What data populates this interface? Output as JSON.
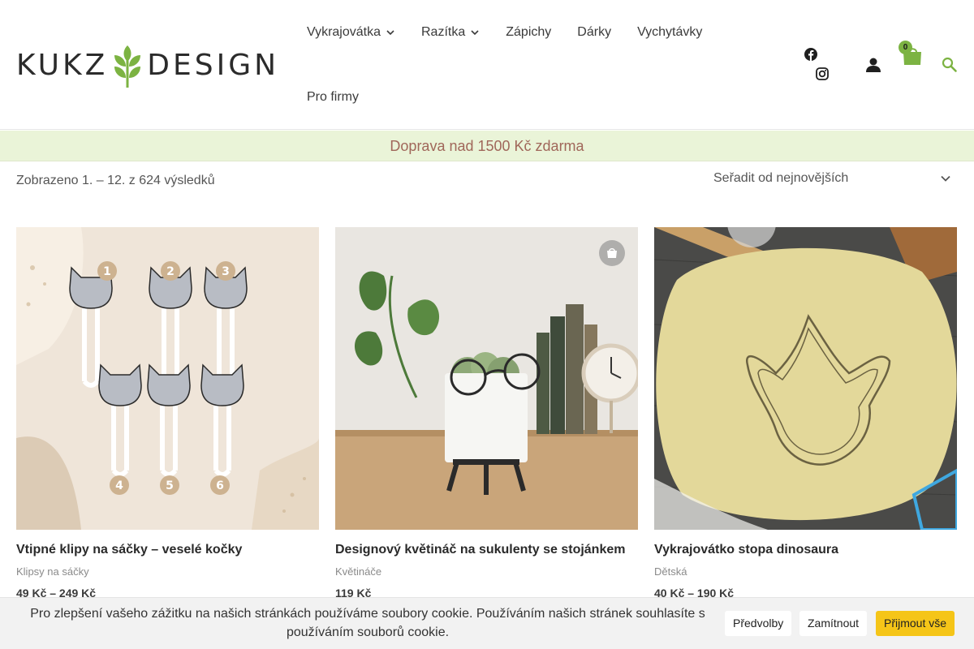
{
  "logo": {
    "left": "KUKZ",
    "right": "DESIGN"
  },
  "nav": {
    "items": [
      {
        "label": "Vykrajovátka",
        "has_dropdown": true
      },
      {
        "label": "Razítka",
        "has_dropdown": true
      },
      {
        "label": "Zápichy",
        "has_dropdown": false
      },
      {
        "label": "Dárky",
        "has_dropdown": false
      },
      {
        "label": "Vychytávky",
        "has_dropdown": false
      },
      {
        "label": "Pro firmy",
        "has_dropdown": false
      }
    ]
  },
  "header_icons": {
    "social": [
      "facebook-icon",
      "instagram-icon"
    ],
    "account": "user-icon",
    "cart": "shopping-bag-icon",
    "cart_count": "0",
    "search": "search-icon"
  },
  "announcement": "Doprava nad 1500 Kč zdarma",
  "toolbar": {
    "result_count": "Zobrazeno 1. – 12. z 624 výsledků",
    "sort_selected": "Seřadit od nejnovějších"
  },
  "products": [
    {
      "title": "Vtipné klipy na sáčky – veselé kočky",
      "category": "Klipsy na sáčky",
      "price": "49 Kč – 249 Kč",
      "numbers": [
        "1",
        "2",
        "3",
        "4",
        "5",
        "6"
      ]
    },
    {
      "title": "Designový květináč na sukulenty se stojánkem",
      "category": "Květináče",
      "price": "119 Kč"
    },
    {
      "title": "Vykrajovátko stopa dinosaura",
      "category": "Dětská",
      "price": "40 Kč – 190 Kč"
    }
  ],
  "cookie": {
    "text": "Pro zlepšení vašeho zážitku na našich stránkách používáme soubory cookie. Používáním našich stránek souhlasíte s používáním souborů cookie.",
    "preferences_label": "Předvolby",
    "reject_label": "Zamítnout",
    "accept_label": "Přijmout vše"
  },
  "colors": {
    "accent_green": "#7cb342",
    "announce_bg": "#eaf4d8",
    "announce_text": "#a0675a",
    "accept_yellow": "#f5c518"
  }
}
